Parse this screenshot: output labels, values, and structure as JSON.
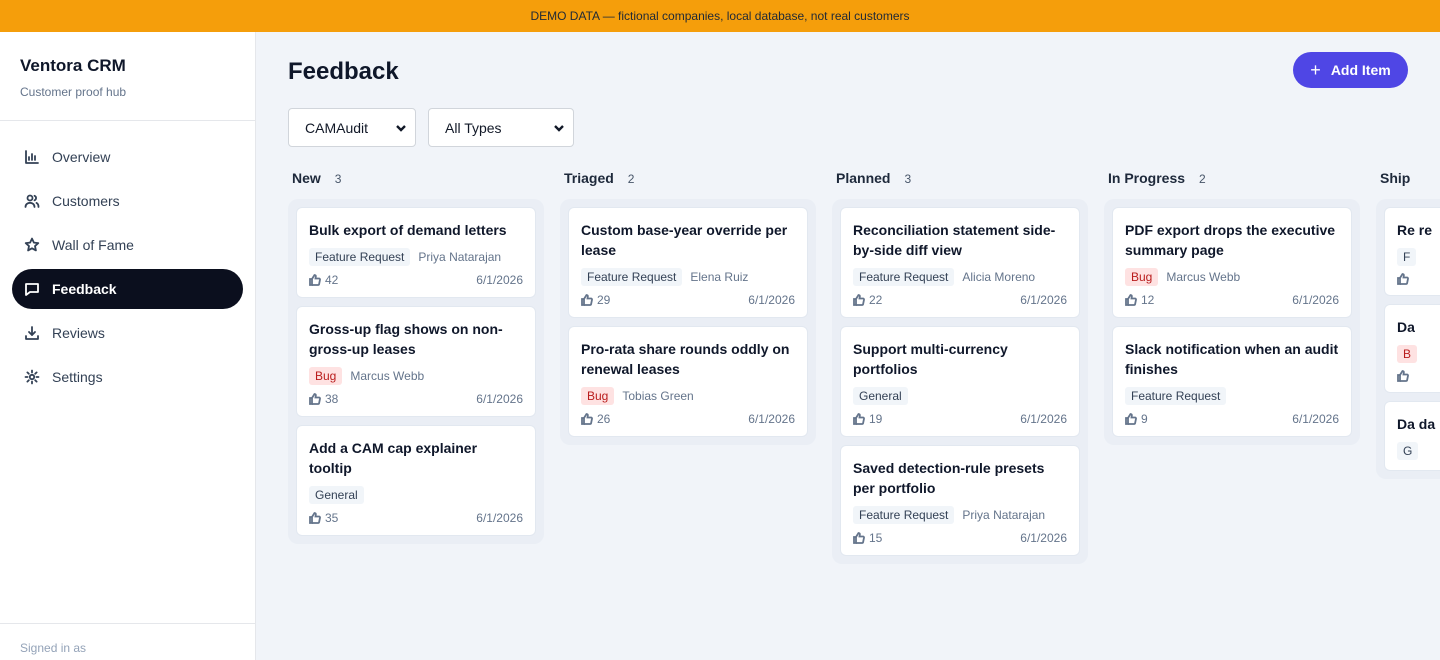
{
  "banner": {
    "text": "DEMO DATA — fictional companies, local database, not real customers"
  },
  "brand": {
    "title": "Ventora CRM",
    "subtitle": "Customer proof hub"
  },
  "nav": [
    {
      "label": "Overview",
      "icon": "bar-chart-icon"
    },
    {
      "label": "Customers",
      "icon": "users-icon"
    },
    {
      "label": "Wall of Fame",
      "icon": "star-icon"
    },
    {
      "label": "Feedback",
      "icon": "message-icon",
      "active": true
    },
    {
      "label": "Reviews",
      "icon": "download-icon"
    },
    {
      "label": "Settings",
      "icon": "gear-icon"
    }
  ],
  "signed_in": "Signed in as",
  "page": {
    "title": "Feedback",
    "add_label": "Add Item"
  },
  "filters": {
    "product": "CAMAudit",
    "type": "All Types"
  },
  "columns": [
    {
      "title": "New",
      "count": "3",
      "cards": [
        {
          "title": "Bulk export of demand letters",
          "tag": "Feature Request",
          "owner": "Priya Natarajan",
          "votes": "42",
          "date": "6/1/2026"
        },
        {
          "title": "Gross-up flag shows on non-gross-up leases",
          "tag": "Bug",
          "owner": "Marcus Webb",
          "votes": "38",
          "date": "6/1/2026"
        },
        {
          "title": "Add a CAM cap explainer tooltip",
          "tag": "General",
          "owner": "",
          "votes": "35",
          "date": "6/1/2026"
        }
      ]
    },
    {
      "title": "Triaged",
      "count": "2",
      "cards": [
        {
          "title": "Custom base-year override per lease",
          "tag": "Feature Request",
          "owner": "Elena Ruiz",
          "votes": "29",
          "date": "6/1/2026"
        },
        {
          "title": "Pro-rata share rounds oddly on renewal leases",
          "tag": "Bug",
          "owner": "Tobias Green",
          "votes": "26",
          "date": "6/1/2026"
        }
      ]
    },
    {
      "title": "Planned",
      "count": "3",
      "cards": [
        {
          "title": "Reconciliation statement side-by-side diff view",
          "tag": "Feature Request",
          "owner": "Alicia Moreno",
          "votes": "22",
          "date": "6/1/2026"
        },
        {
          "title": "Support multi-currency portfolios",
          "tag": "General",
          "owner": "",
          "votes": "19",
          "date": "6/1/2026"
        },
        {
          "title": "Saved detection-rule presets per portfolio",
          "tag": "Feature Request",
          "owner": "Priya Natarajan",
          "votes": "15",
          "date": "6/1/2026"
        }
      ]
    },
    {
      "title": "In Progress",
      "count": "2",
      "cards": [
        {
          "title": "PDF export drops the executive summary page",
          "tag": "Bug",
          "owner": "Marcus Webb",
          "votes": "12",
          "date": "6/1/2026"
        },
        {
          "title": "Slack notification when an audit finishes",
          "tag": "Feature Request",
          "owner": "",
          "votes": "9",
          "date": "6/1/2026"
        }
      ]
    },
    {
      "title": "Ship",
      "count": "",
      "cards": [
        {
          "title": "Re re",
          "tag": "F",
          "owner": "",
          "votes": "",
          "date": ""
        },
        {
          "title": "Da",
          "tag": "B",
          "owner": "",
          "votes": "",
          "date": ""
        },
        {
          "title": "Da da",
          "tag": "G",
          "owner": "",
          "votes": "",
          "date": ""
        }
      ]
    }
  ]
}
